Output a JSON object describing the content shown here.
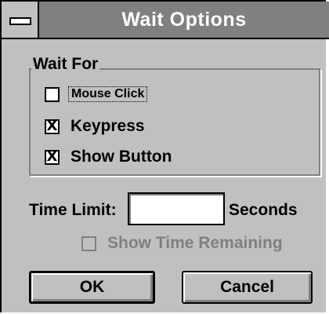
{
  "window": {
    "title": "Wait Options"
  },
  "wait_for": {
    "label": "Wait For",
    "options": [
      {
        "label": "Mouse Click",
        "checked": false
      },
      {
        "label": "Keypress",
        "checked": true
      },
      {
        "label": "Show Button",
        "checked": true
      }
    ]
  },
  "time_limit": {
    "label": "Time Limit:",
    "value": "",
    "unit": "Seconds",
    "show_remaining_label": "Show Time Remaining",
    "show_remaining_checked": false,
    "show_remaining_enabled": false
  },
  "buttons": {
    "ok": "OK",
    "cancel": "Cancel"
  },
  "check_mark": "X"
}
